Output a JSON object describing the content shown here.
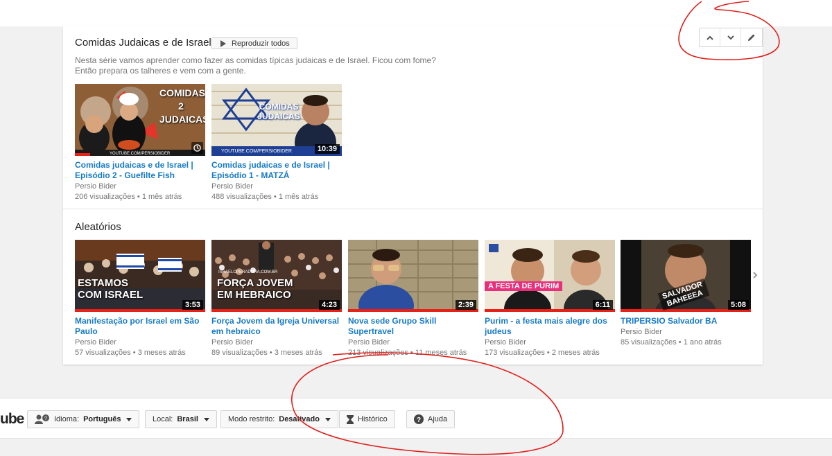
{
  "playlist": {
    "title": "Comidas Judaicas e de Israel",
    "play_all_label": "Reproduzir todos",
    "description": "Nesta série vamos aprender como fazer as comidas típicas judaicas e de Israel. Ficou com fome? Então prepara os talheres e vem com a gente.",
    "videos": [
      {
        "title": "Comidas judaicas e de Israel | Episódio 2 - Guefilte Fish",
        "channel": "Persio Bider",
        "views": "206 visualizações",
        "age": "1 mês atrás",
        "duration": "",
        "thumb_text": "COMIDAS 2 JUDAICAS",
        "thumb_caption": "YOUTUBE.COM/PERSIOBIDER"
      },
      {
        "title": "Comidas judaicas e de Israel | Episódio 1 - MATZÁ",
        "channel": "Persio Bider",
        "views": "488 visualizações",
        "age": "1 mês atrás",
        "duration": "10:39",
        "thumb_text": "COMIDAS JUDAICAS",
        "thumb_caption": "YOUTUBE.COM/PERSIOBIDER"
      }
    ]
  },
  "random": {
    "title": "Aleatórios",
    "videos": [
      {
        "title": "Manifestação por Israel em São Paulo",
        "channel": "Persio Bider",
        "views": "57 visualizações",
        "age": "3 meses atrás",
        "duration": "3:53",
        "thumb_text": "ESTAMOS COM ISRAEL"
      },
      {
        "title": "Força Jovem da Igreja Universal em hebraico",
        "channel": "Persio Bider",
        "views": "89 visualizações",
        "age": "3 meses atrás",
        "duration": "4:23",
        "thumb_text": "FORÇA JOVEM EM HEBRAICO",
        "thumb_caption": "ISRAELOPERADORA.COM.BR"
      },
      {
        "title": "Nova sede Grupo Skill Supertravel",
        "channel": "Persio Bider",
        "views": "213 visualizações",
        "age": "11 meses atrás",
        "duration": "2:39",
        "thumb_text": ""
      },
      {
        "title": "Purim - a festa mais alegre dos judeus",
        "channel": "Persio Bider",
        "views": "173 visualizações",
        "age": "2 meses atrás",
        "duration": "6:11",
        "thumb_text": "A FESTA DE PURIM"
      },
      {
        "title": "TRIPERSIO Salvador BA",
        "channel": "Persio Bider",
        "views": "85 visualizações",
        "age": "1 ano atrás",
        "duration": "5:08",
        "thumb_text": "SALVADOR BAHEEEA"
      }
    ]
  },
  "meta_separator": "•",
  "footer": {
    "logo_fragment": "ube",
    "language_label": "Idioma:",
    "language_value": "Português",
    "location_label": "Local:",
    "location_value": "Brasil",
    "restricted_label": "Modo restrito:",
    "restricted_value": "Desativado",
    "history_label": "Histórico",
    "help_label": "Ajuda"
  },
  "colors": {
    "link": "#167ac6",
    "meta": "#767676",
    "annotation": "#e0201c",
    "progress": "#e62117"
  }
}
